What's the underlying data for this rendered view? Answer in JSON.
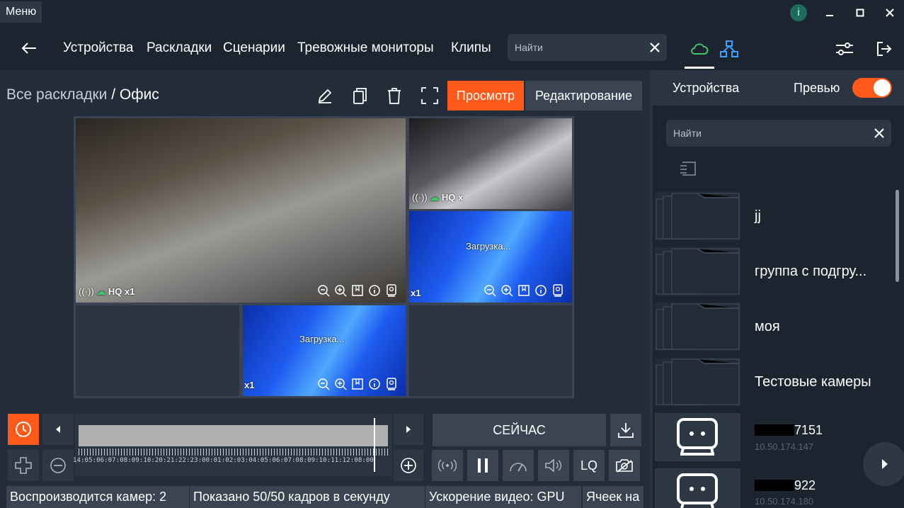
{
  "window": {
    "menu_label": "Меню",
    "info_glyph": "i"
  },
  "nav": {
    "items": [
      "Устройства",
      "Раскладки",
      "Сценарии",
      "Тревожные мониторы",
      "Клипы"
    ],
    "search_placeholder": "Найти"
  },
  "breadcrumb": {
    "root": "Все раскладки",
    "separator": " / ",
    "current": "Офис"
  },
  "mode": {
    "view_label": "Просмотр",
    "edit_label": "Редактирование"
  },
  "cells": {
    "main_quality": "HQ x1",
    "small_quality": "HQ x",
    "loading": "Загрузка...",
    "speed": "x1"
  },
  "timeline": {
    "times": "14:05:06:07:08:09:10:20:21:22:23:00:01:02:03:04:05:06:07:08:09:10:11:12:08:00",
    "now_label": "СЕЙЧАС",
    "quality_label": "LQ"
  },
  "status": {
    "cameras": "Воспроизводится камер: 2",
    "frames": "Показано 50/50 кадров в секунду",
    "accel": "Ускорение видео: GPU",
    "cells": "Ячеек на"
  },
  "right_panel": {
    "tab_label": "Устройства",
    "preview_label": "Превью",
    "preview_on": true,
    "search_placeholder": "Найти",
    "folders": [
      "jj",
      "группа с подгру...",
      "моя",
      "Тестовые камеры"
    ],
    "cameras": [
      {
        "name_suffix": "7151",
        "ip": "10.50.174.147"
      },
      {
        "name_suffix": "922",
        "ip": "10.50.174.180"
      }
    ]
  },
  "colors": {
    "accent": "#ff5a1a",
    "background": "#1c2430",
    "cloud_green": "#3ec46d",
    "network_blue": "#3aa0ff"
  }
}
